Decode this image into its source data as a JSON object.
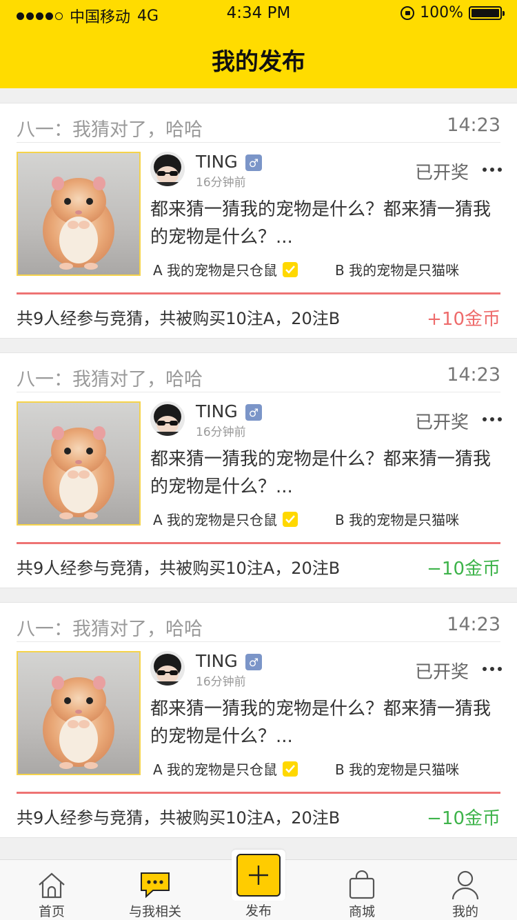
{
  "status_bar": {
    "carrier": "中国移动",
    "network": "4G",
    "time": "4:34 PM",
    "battery": "100%"
  },
  "header": {
    "title": "我的发布"
  },
  "colors": {
    "brand_yellow": "#ffdc00",
    "win_green": "#3db34a",
    "loss_red": "#ee6b6b",
    "gender_blue": "#7b95c8"
  },
  "posts": [
    {
      "title": "八一：我猜对了，哈哈",
      "time": "14:23",
      "username": "TING",
      "gender_icon": "male-icon",
      "time_ago": "16分钟前",
      "status": "已开奖",
      "question": "都来猜一猜我的宠物是什么？都来猜一猜我的宠物是什么？...",
      "option_a": "A 我的宠物是只仓鼠",
      "option_b": "B 我的宠物是只猫咪",
      "selected": "A",
      "summary": "共9人经参与竞猜，共被购买10注A，20注B",
      "reward": "+10金币",
      "reward_color": "#ee6b6b"
    },
    {
      "title": "八一：我猜对了，哈哈",
      "time": "14:23",
      "username": "TING",
      "gender_icon": "male-icon",
      "time_ago": "16分钟前",
      "status": "已开奖",
      "question": "都来猜一猜我的宠物是什么？都来猜一猜我的宠物是什么？...",
      "option_a": "A 我的宠物是只仓鼠",
      "option_b": "B 我的宠物是只猫咪",
      "selected": "A",
      "summary": "共9人经参与竞猜，共被购买10注A，20注B",
      "reward": "−10金币",
      "reward_color": "#3db34a"
    },
    {
      "title": "八一：我猜对了，哈哈",
      "time": "14:23",
      "username": "TING",
      "gender_icon": "male-icon",
      "time_ago": "16分钟前",
      "status": "已开奖",
      "question": "都来猜一猜我的宠物是什么？都来猜一猜我的宠物是什么？...",
      "option_a": "A 我的宠物是只仓鼠",
      "option_b": "B 我的宠物是只猫咪",
      "selected": "A",
      "summary": "共9人经参与竞猜，共被购买10注A，20注B",
      "reward": "−10金币",
      "reward_color": "#3db34a"
    }
  ],
  "tabbar": {
    "items": [
      {
        "label": "首页",
        "icon": "home-icon"
      },
      {
        "label": "与我相关",
        "icon": "chat-bubble-icon"
      },
      {
        "label": "发布",
        "icon": "plus-icon"
      },
      {
        "label": "商城",
        "icon": "shopping-bag-icon"
      },
      {
        "label": "我的",
        "icon": "user-icon"
      }
    ]
  }
}
